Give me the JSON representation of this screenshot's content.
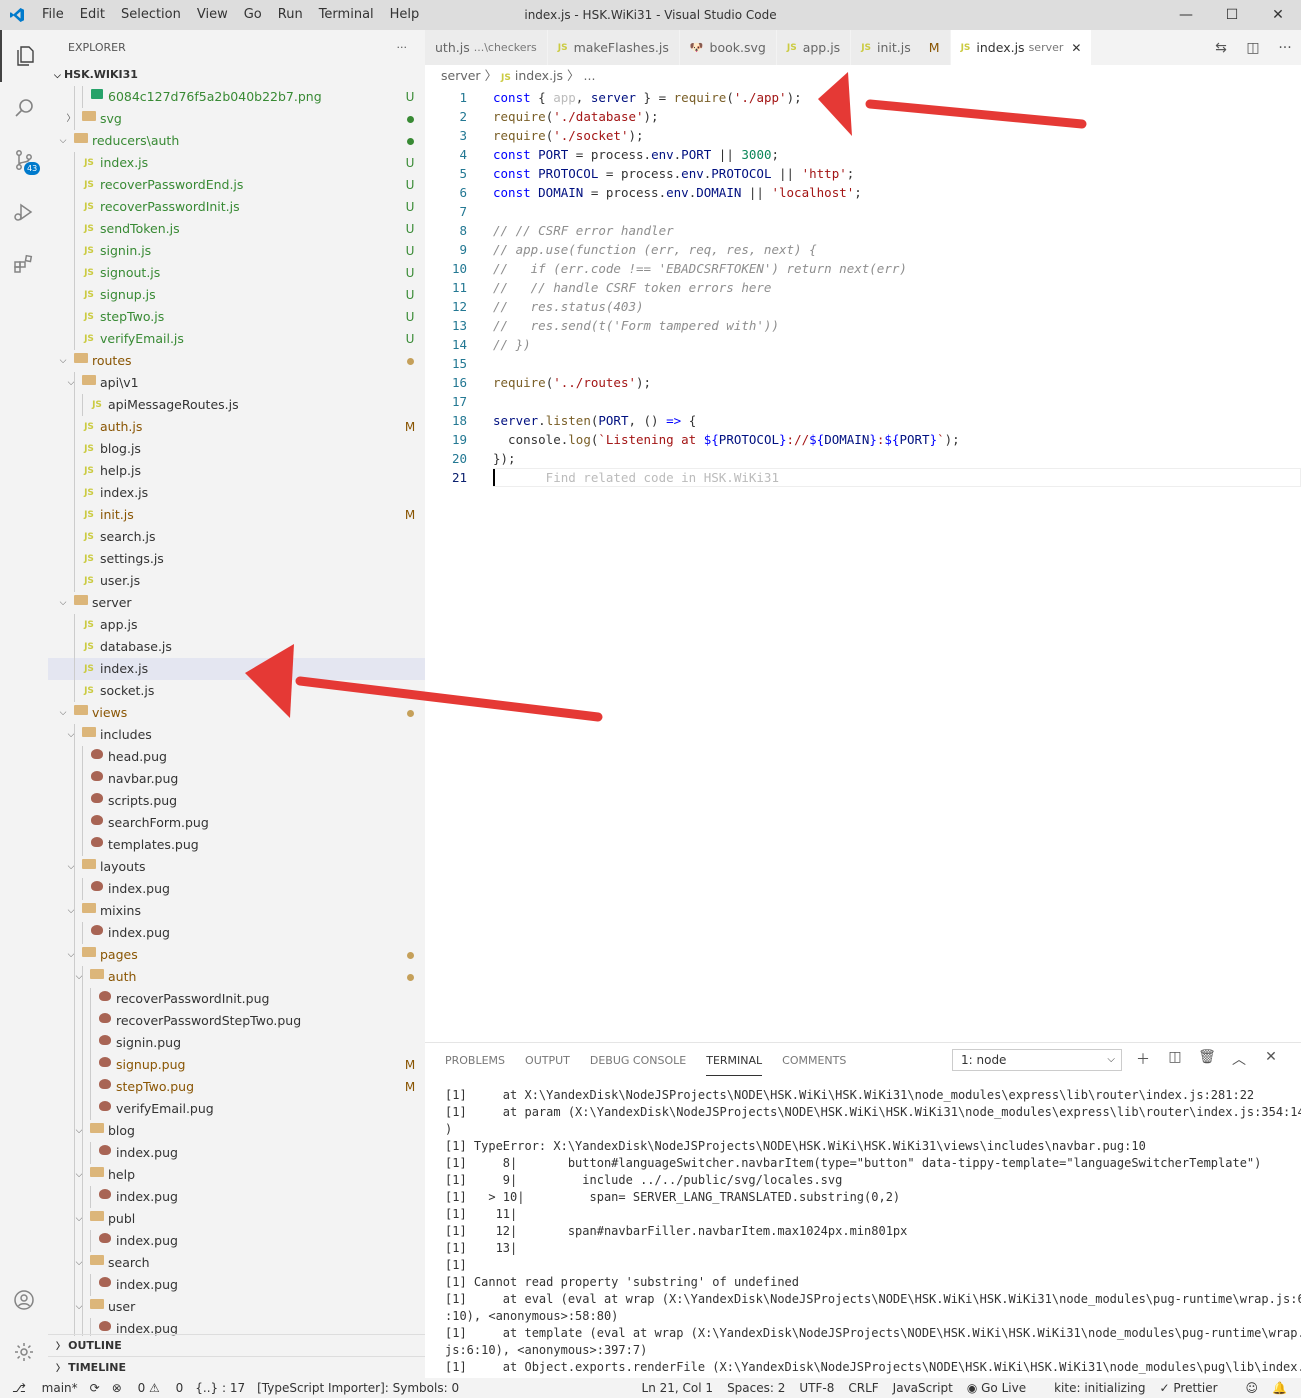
{
  "window": {
    "title": "index.js - HSK.WiKi31 - Visual Studio Code",
    "menu": [
      "File",
      "Edit",
      "Selection",
      "View",
      "Go",
      "Run",
      "Terminal",
      "Help"
    ],
    "controls": [
      "—",
      "☐",
      "✕"
    ]
  },
  "activity": {
    "scm_badge": "43"
  },
  "sidebar": {
    "title": "EXPLORER",
    "more": "···",
    "root": "HSK.WIKI31",
    "outline": "OUTLINE",
    "timeline": "TIMELINE",
    "tree": [
      {
        "d": 3,
        "t": "file",
        "icon": "img",
        "label": "6084c127d76f5a2b040b22b7.png",
        "cls": "g",
        "st": "U"
      },
      {
        "d": 2,
        "t": "folder",
        "open": false,
        "label": "svg",
        "cls": "g",
        "st": "dot"
      },
      {
        "d": 1,
        "t": "folder",
        "open": true,
        "label": "reducers\\auth",
        "cls": "g",
        "st": "dot"
      },
      {
        "d": 2,
        "t": "file",
        "icon": "js",
        "label": "index.js",
        "cls": "g",
        "st": "U"
      },
      {
        "d": 2,
        "t": "file",
        "icon": "js",
        "label": "recoverPasswordEnd.js",
        "cls": "g",
        "st": "U"
      },
      {
        "d": 2,
        "t": "file",
        "icon": "js",
        "label": "recoverPasswordInit.js",
        "cls": "g",
        "st": "U"
      },
      {
        "d": 2,
        "t": "file",
        "icon": "js",
        "label": "sendToken.js",
        "cls": "g",
        "st": "U"
      },
      {
        "d": 2,
        "t": "file",
        "icon": "js",
        "label": "signin.js",
        "cls": "g",
        "st": "U"
      },
      {
        "d": 2,
        "t": "file",
        "icon": "js",
        "label": "signout.js",
        "cls": "g",
        "st": "U"
      },
      {
        "d": 2,
        "t": "file",
        "icon": "js",
        "label": "signup.js",
        "cls": "g",
        "st": "U"
      },
      {
        "d": 2,
        "t": "file",
        "icon": "js",
        "label": "stepTwo.js",
        "cls": "g",
        "st": "U"
      },
      {
        "d": 2,
        "t": "file",
        "icon": "js",
        "label": "verifyEmail.js",
        "cls": "g",
        "st": "U"
      },
      {
        "d": 1,
        "t": "folder",
        "open": true,
        "label": "routes",
        "cls": "m",
        "st": "dot"
      },
      {
        "d": 2,
        "t": "folder",
        "open": true,
        "label": "api\\v1",
        "cls": "",
        "st": ""
      },
      {
        "d": 3,
        "t": "file",
        "icon": "js",
        "label": "apiMessageRoutes.js",
        "cls": "",
        "st": ""
      },
      {
        "d": 2,
        "t": "file",
        "icon": "js",
        "label": "auth.js",
        "cls": "m",
        "st": "M"
      },
      {
        "d": 2,
        "t": "file",
        "icon": "js",
        "label": "blog.js",
        "cls": "",
        "st": ""
      },
      {
        "d": 2,
        "t": "file",
        "icon": "js",
        "label": "help.js",
        "cls": "",
        "st": ""
      },
      {
        "d": 2,
        "t": "file",
        "icon": "js",
        "label": "index.js",
        "cls": "",
        "st": ""
      },
      {
        "d": 2,
        "t": "file",
        "icon": "js",
        "label": "init.js",
        "cls": "m",
        "st": "M"
      },
      {
        "d": 2,
        "t": "file",
        "icon": "js",
        "label": "search.js",
        "cls": "",
        "st": ""
      },
      {
        "d": 2,
        "t": "file",
        "icon": "js",
        "label": "settings.js",
        "cls": "",
        "st": ""
      },
      {
        "d": 2,
        "t": "file",
        "icon": "js",
        "label": "user.js",
        "cls": "",
        "st": ""
      },
      {
        "d": 1,
        "t": "folder",
        "open": true,
        "label": "server",
        "cls": "",
        "st": ""
      },
      {
        "d": 2,
        "t": "file",
        "icon": "js",
        "label": "app.js",
        "cls": "",
        "st": ""
      },
      {
        "d": 2,
        "t": "file",
        "icon": "js",
        "label": "database.js",
        "cls": "",
        "st": ""
      },
      {
        "d": 2,
        "t": "file",
        "icon": "js",
        "label": "index.js",
        "cls": "",
        "st": "",
        "sel": true
      },
      {
        "d": 2,
        "t": "file",
        "icon": "js",
        "label": "socket.js",
        "cls": "",
        "st": ""
      },
      {
        "d": 1,
        "t": "folder",
        "open": true,
        "label": "views",
        "cls": "m",
        "st": "dot"
      },
      {
        "d": 2,
        "t": "folder",
        "open": true,
        "label": "includes",
        "cls": "",
        "st": ""
      },
      {
        "d": 3,
        "t": "file",
        "icon": "pug",
        "label": "head.pug",
        "cls": "",
        "st": ""
      },
      {
        "d": 3,
        "t": "file",
        "icon": "pug",
        "label": "navbar.pug",
        "cls": "",
        "st": ""
      },
      {
        "d": 3,
        "t": "file",
        "icon": "pug",
        "label": "scripts.pug",
        "cls": "",
        "st": ""
      },
      {
        "d": 3,
        "t": "file",
        "icon": "pug",
        "label": "searchForm.pug",
        "cls": "",
        "st": ""
      },
      {
        "d": 3,
        "t": "file",
        "icon": "pug",
        "label": "templates.pug",
        "cls": "",
        "st": ""
      },
      {
        "d": 2,
        "t": "folder",
        "open": true,
        "label": "layouts",
        "cls": "",
        "st": ""
      },
      {
        "d": 3,
        "t": "file",
        "icon": "pug",
        "label": "index.pug",
        "cls": "",
        "st": ""
      },
      {
        "d": 2,
        "t": "folder",
        "open": true,
        "label": "mixins",
        "cls": "",
        "st": ""
      },
      {
        "d": 3,
        "t": "file",
        "icon": "pug",
        "label": "index.pug",
        "cls": "",
        "st": ""
      },
      {
        "d": 2,
        "t": "folder",
        "open": true,
        "label": "pages",
        "cls": "m",
        "st": "dot"
      },
      {
        "d": 3,
        "t": "folder",
        "open": true,
        "label": "auth",
        "cls": "m",
        "st": "dot"
      },
      {
        "d": 4,
        "t": "file",
        "icon": "pug",
        "label": "recoverPasswordInit.pug",
        "cls": "",
        "st": ""
      },
      {
        "d": 4,
        "t": "file",
        "icon": "pug",
        "label": "recoverPasswordStepTwo.pug",
        "cls": "",
        "st": ""
      },
      {
        "d": 4,
        "t": "file",
        "icon": "pug",
        "label": "signin.pug",
        "cls": "",
        "st": ""
      },
      {
        "d": 4,
        "t": "file",
        "icon": "pug",
        "label": "signup.pug",
        "cls": "m",
        "st": "M"
      },
      {
        "d": 4,
        "t": "file",
        "icon": "pug",
        "label": "stepTwo.pug",
        "cls": "m",
        "st": "M"
      },
      {
        "d": 4,
        "t": "file",
        "icon": "pug",
        "label": "verifyEmail.pug",
        "cls": "",
        "st": ""
      },
      {
        "d": 3,
        "t": "folder",
        "open": true,
        "label": "blog",
        "cls": "",
        "st": ""
      },
      {
        "d": 4,
        "t": "file",
        "icon": "pug",
        "label": "index.pug",
        "cls": "",
        "st": ""
      },
      {
        "d": 3,
        "t": "folder",
        "open": true,
        "label": "help",
        "cls": "",
        "st": ""
      },
      {
        "d": 4,
        "t": "file",
        "icon": "pug",
        "label": "index.pug",
        "cls": "",
        "st": ""
      },
      {
        "d": 3,
        "t": "folder",
        "open": true,
        "label": "publ",
        "cls": "",
        "st": ""
      },
      {
        "d": 4,
        "t": "file",
        "icon": "pug",
        "label": "index.pug",
        "cls": "",
        "st": ""
      },
      {
        "d": 3,
        "t": "folder",
        "open": true,
        "label": "search",
        "cls": "",
        "st": ""
      },
      {
        "d": 4,
        "t": "file",
        "icon": "pug",
        "label": "index.pug",
        "cls": "",
        "st": ""
      },
      {
        "d": 3,
        "t": "folder",
        "open": true,
        "label": "user",
        "cls": "",
        "st": ""
      },
      {
        "d": 4,
        "t": "file",
        "icon": "pug",
        "label": "index.pug",
        "cls": "",
        "st": ""
      }
    ]
  },
  "tabs": [
    {
      "label": "uth.js",
      "sub": "...\\checkers",
      "js": false
    },
    {
      "label": "makeFlashes.js",
      "js": true
    },
    {
      "label": "book.svg",
      "svg": true
    },
    {
      "label": "app.js",
      "js": true
    },
    {
      "label": "init.js",
      "js": true,
      "mod": "M"
    },
    {
      "label": "index.js",
      "sub": "server",
      "js": true,
      "active": true,
      "close": "✕"
    }
  ],
  "breadcrumb": {
    "a": "server",
    "b": "index.js",
    "c": "..."
  },
  "code": [
    [
      [
        "k",
        "const "
      ],
      [
        "p",
        "{ "
      ],
      [
        "ghost",
        "app"
      ],
      [
        "p",
        ", "
      ],
      [
        "v",
        "server"
      ],
      [
        "p",
        " } = "
      ],
      [
        "f",
        "require"
      ],
      [
        "p",
        "("
      ],
      [
        "s",
        "'./app'"
      ],
      [
        "p",
        ");"
      ]
    ],
    [
      [
        "f",
        "require"
      ],
      [
        "p",
        "("
      ],
      [
        "s",
        "'./database'"
      ],
      [
        "p",
        ");"
      ]
    ],
    [
      [
        "f",
        "require"
      ],
      [
        "p",
        "("
      ],
      [
        "s",
        "'./socket'"
      ],
      [
        "p",
        ");"
      ]
    ],
    [
      [
        "k",
        "const "
      ],
      [
        "v",
        "PORT"
      ],
      [
        "p",
        " = process."
      ],
      [
        "v",
        "env"
      ],
      [
        "p",
        "."
      ],
      [
        "v",
        "PORT"
      ],
      [
        "p",
        " || "
      ],
      [
        "n",
        "3000"
      ],
      [
        "p",
        ";"
      ]
    ],
    [
      [
        "k",
        "const "
      ],
      [
        "v",
        "PROTOCOL"
      ],
      [
        "p",
        " = process."
      ],
      [
        "v",
        "env"
      ],
      [
        "p",
        "."
      ],
      [
        "v",
        "PROTOCOL"
      ],
      [
        "p",
        " || "
      ],
      [
        "s",
        "'http'"
      ],
      [
        "p",
        ";"
      ]
    ],
    [
      [
        "k",
        "const "
      ],
      [
        "v",
        "DOMAIN"
      ],
      [
        "p",
        " = process."
      ],
      [
        "v",
        "env"
      ],
      [
        "p",
        "."
      ],
      [
        "v",
        "DOMAIN"
      ],
      [
        "p",
        " || "
      ],
      [
        "s",
        "'localhost'"
      ],
      [
        "p",
        ";"
      ]
    ],
    [],
    [
      [
        "cm",
        "// // CSRF error handler"
      ]
    ],
    [
      [
        "cm",
        "// app.use(function (err, req, res, next) {"
      ]
    ],
    [
      [
        "cm",
        "//   if (err.code !== 'EBADCSRFTOKEN') return next(err)"
      ]
    ],
    [
      [
        "cm",
        "//   // handle CSRF token errors here"
      ]
    ],
    [
      [
        "cm",
        "//   res.status(403)"
      ]
    ],
    [
      [
        "cm",
        "//   res.send(t('Form tampered with'))"
      ]
    ],
    [
      [
        "cm",
        "// })"
      ]
    ],
    [],
    [
      [
        "f",
        "require"
      ],
      [
        "p",
        "("
      ],
      [
        "s",
        "'../routes'"
      ],
      [
        "p",
        ");"
      ]
    ],
    [],
    [
      [
        "v",
        "server"
      ],
      [
        "p",
        "."
      ],
      [
        "f",
        "listen"
      ],
      [
        "p",
        "("
      ],
      [
        "v",
        "PORT"
      ],
      [
        "p",
        ", () "
      ],
      [
        "k",
        "=>"
      ],
      [
        "p",
        " {"
      ]
    ],
    [
      [
        "p",
        "  console."
      ],
      [
        "f",
        "log"
      ],
      [
        "p",
        "("
      ],
      [
        "s",
        "`Listening at "
      ],
      [
        "k",
        "${"
      ],
      [
        "v",
        "PROTOCOL"
      ],
      [
        "k",
        "}"
      ],
      [
        "s",
        "://"
      ],
      [
        "k",
        "${"
      ],
      [
        "v",
        "DOMAIN"
      ],
      [
        "k",
        "}"
      ],
      [
        "s",
        ":"
      ],
      [
        "k",
        "${"
      ],
      [
        "v",
        "PORT"
      ],
      [
        "k",
        "}"
      ],
      [
        "s",
        "`"
      ],
      [
        "p",
        ");"
      ]
    ],
    [
      [
        "p",
        "});"
      ]
    ],
    [
      [
        "ghost",
        "       Find related code in HSK.WiKi31"
      ]
    ]
  ],
  "panel": {
    "tabs": [
      "PROBLEMS",
      "OUTPUT",
      "DEBUG CONSOLE",
      "TERMINAL",
      "COMMENTS"
    ],
    "active": "TERMINAL",
    "select": "1: node",
    "terminal": [
      "[1]     at X:\\YandexDisk\\NodeJSProjects\\NODE\\HSK.WiKi\\HSK.WiKi31\\node_modules\\express\\lib\\router\\index.js:281:22",
      "[1]     at param (X:\\YandexDisk\\NodeJSProjects\\NODE\\HSK.WiKi\\HSK.WiKi31\\node_modules\\express\\lib\\router\\index.js:354:14",
      ")",
      "[1] TypeError: X:\\YandexDisk\\NodeJSProjects\\NODE\\HSK.WiKi\\HSK.WiKi31\\views\\includes\\navbar.pug:10",
      "[1]     8|       button#languageSwitcher.navbarItem(type=\"button\" data-tippy-template=\"languageSwitcherTemplate\")",
      "[1]     9|         include ../../public/svg/locales.svg",
      "[1]   > 10|         span= SERVER_LANG_TRANSLATED.substring(0,2)",
      "[1]    11|",
      "[1]    12|       span#navbarFiller.navbarItem.max1024px.min801px",
      "[1]    13|",
      "[1]",
      "[1] Cannot read property 'substring' of undefined",
      "[1]     at eval (eval at wrap (X:\\YandexDisk\\NodeJSProjects\\NODE\\HSK.WiKi\\HSK.WiKi31\\node_modules\\pug-runtime\\wrap.js:6",
      ":10), <anonymous>:58:80)",
      "[1]     at template (eval at wrap (X:\\YandexDisk\\NodeJSProjects\\NODE\\HSK.WiKi\\HSK.WiKi31\\node_modules\\pug-runtime\\wrap.",
      "js:6:10), <anonymous>:397:7)",
      "[1]     at Object.exports.renderFile (X:\\YandexDisk\\NodeJSProjects\\NODE\\HSK.WiKi\\HSK.WiKi31\\node_modules\\pug\\lib\\index."
    ]
  },
  "status": {
    "branch": "main*",
    "errors": "0",
    "warnings": "0",
    "braces": "{..} : 17",
    "importer": "[TypeScript Importer]: Symbols: 0",
    "position": "Ln 21, Col 1",
    "spaces": "Spaces: 2",
    "encoding": "UTF-8",
    "eol": "CRLF",
    "language": "JavaScript",
    "golive": "Go Live",
    "kite": "kite: initializing",
    "prettier": "Prettier"
  },
  "colors": {
    "accent": "#007acc",
    "untracked": "#388a34",
    "modified": "#895503",
    "arrow": "#e53935"
  }
}
